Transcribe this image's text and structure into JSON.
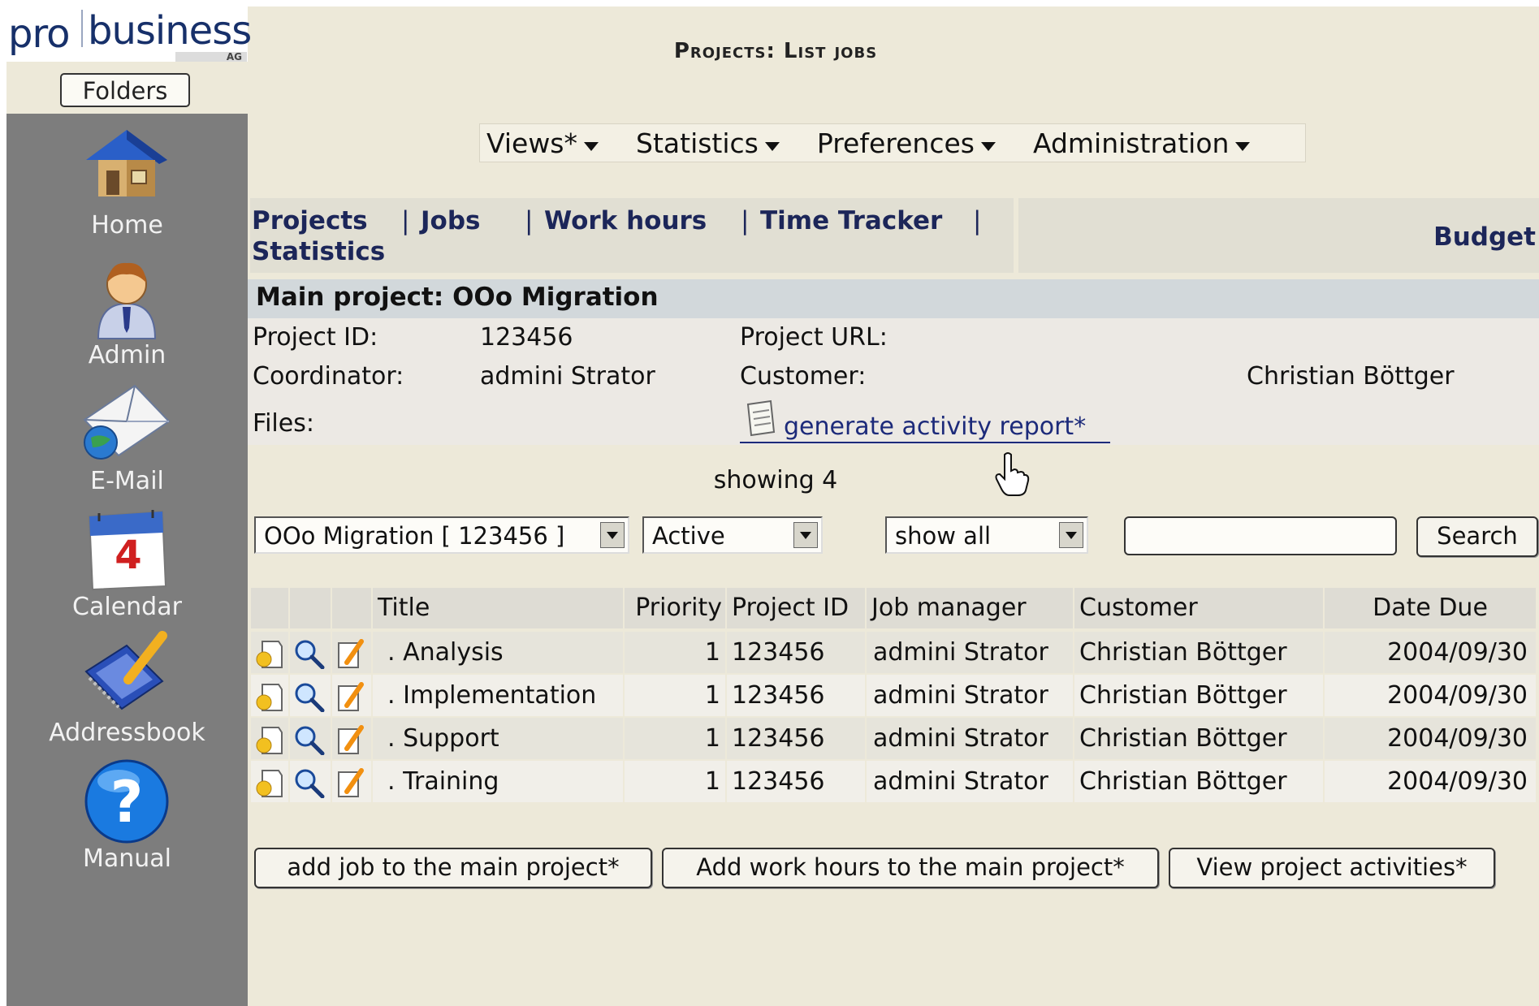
{
  "logo": {
    "text_pro": "pro",
    "text_business": "business",
    "text_ag": "AG"
  },
  "sidebar": {
    "folders_label": "Folders",
    "items": [
      {
        "label": "Home",
        "icon": "home-icon"
      },
      {
        "label": "Admin",
        "icon": "admin-icon"
      },
      {
        "label": "E-Mail",
        "icon": "email-icon"
      },
      {
        "label": "Calendar",
        "icon": "calendar-icon"
      },
      {
        "label": "Addressbook",
        "icon": "addressbook-icon"
      },
      {
        "label": "Manual",
        "icon": "help-icon"
      }
    ]
  },
  "header": {
    "title": "Projects: List jobs"
  },
  "menubar": [
    "Views*",
    "Statistics",
    "Preferences",
    "Administration"
  ],
  "tabs": {
    "links": [
      "Projects",
      "Jobs",
      "Work hours",
      "Time Tracker",
      "Statistics"
    ],
    "separator": "|",
    "right": "Budget"
  },
  "project": {
    "header": "Main project: OOo Migration",
    "id_label": "Project ID:",
    "id_value": "123456",
    "url_label": "Project URL:",
    "coordinator_label": "Coordinator:",
    "coordinator_value": "admini Strator",
    "customer_label": "Customer:",
    "customer_value": "Christian Böttger",
    "files_label": "Files:",
    "report_link": "generate activity report*"
  },
  "showing": "showing 4",
  "filters": {
    "project_select": "OOo Migration [ 123456 ]",
    "status_select": "Active",
    "show_select": "show all",
    "search_value": "",
    "search_button": "Search"
  },
  "table": {
    "headers": [
      "Title",
      "Priority",
      "Project ID",
      "Job manager",
      "Customer",
      "Date Due"
    ],
    "rows": [
      {
        "title": ". Analysis",
        "priority": "1",
        "project_id": "123456",
        "manager": "admini Strator",
        "customer": "Christian Böttger",
        "due": "2004/09/30"
      },
      {
        "title": ". Implementation",
        "priority": "1",
        "project_id": "123456",
        "manager": "admini Strator",
        "customer": "Christian Böttger",
        "due": "2004/09/30"
      },
      {
        "title": ". Support",
        "priority": "1",
        "project_id": "123456",
        "manager": "admini Strator",
        "customer": "Christian Böttger",
        "due": "2004/09/30"
      },
      {
        "title": ". Training",
        "priority": "1",
        "project_id": "123456",
        "manager": "admini Strator",
        "customer": "Christian Böttger",
        "due": "2004/09/30"
      }
    ]
  },
  "actions": [
    "add job to the main project*",
    "Add work hours to the main project*",
    "View project activities*"
  ]
}
